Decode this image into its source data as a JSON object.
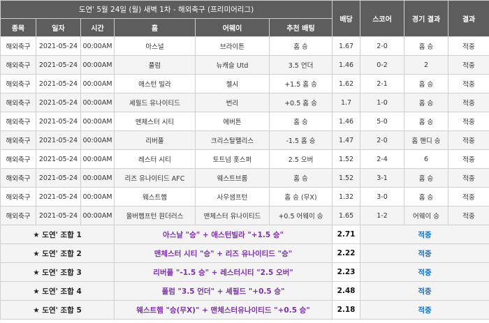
{
  "title": "도연' 5월 24일 (월) 새벽 1차 - 해외축구 (프리미어리그)",
  "headers": {
    "sport": "종목",
    "date": "일자",
    "time": "시간",
    "home": "홈",
    "away": "어웨이",
    "pick": "추천 배팅",
    "odds": "배당",
    "score": "스코어",
    "match_result": "경기 결과",
    "result": "결과"
  },
  "matches": [
    {
      "sport": "해외축구",
      "date": "2021-05-24",
      "time": "00:00AM",
      "home": "아스널",
      "away": "브라이튼",
      "pick": "홈 승",
      "odds": "1.67",
      "score": "2-0",
      "match_result": "홈 승",
      "result": "적중"
    },
    {
      "sport": "해외축구",
      "date": "2021-05-24",
      "time": "00:00AM",
      "home": "풀럼",
      "away": "뉴캐슬 Utd",
      "pick": "3.5 언더",
      "odds": "1.46",
      "score": "0-2",
      "match_result": "2",
      "result": "적중"
    },
    {
      "sport": "해외축구",
      "date": "2021-05-24",
      "time": "00:00AM",
      "home": "애스턴 빌라",
      "away": "첼시",
      "pick": "+1.5 홈 승",
      "odds": "1.62",
      "score": "2-1",
      "match_result": "홈 승",
      "result": "적중"
    },
    {
      "sport": "해외축구",
      "date": "2021-05-24",
      "time": "00:00AM",
      "home": "셰필드 유나이티드",
      "away": "번리",
      "pick": "+0.5 홈 승",
      "odds": "1.7",
      "score": "1-0",
      "match_result": "홈 승",
      "result": "적중"
    },
    {
      "sport": "해외축구",
      "date": "2021-05-24",
      "time": "00:00AM",
      "home": "맨체스터 시티",
      "away": "에버튼",
      "pick": "홈 승",
      "odds": "1.46",
      "score": "5-0",
      "match_result": "홈 승",
      "result": "적중"
    },
    {
      "sport": "해외축구",
      "date": "2021-05-24",
      "time": "00:00AM",
      "home": "리버풀",
      "away": "크리스탈팰리스",
      "pick": "-1.5 홈 승",
      "odds": "1.47",
      "score": "2-0",
      "match_result": "홈 핸디 승",
      "result": "적중"
    },
    {
      "sport": "해외축구",
      "date": "2021-05-24",
      "time": "00:00AM",
      "home": "레스터 시티",
      "away": "토트넘 홋스퍼",
      "pick": "2.5 오버",
      "odds": "1.52",
      "score": "2-4",
      "match_result": "6",
      "result": "적중"
    },
    {
      "sport": "해외축구",
      "date": "2021-05-24",
      "time": "00:00AM",
      "home": "리즈 유나이티드 AFC",
      "away": "웨스트브롬",
      "pick": "홈 승",
      "odds": "1.52",
      "score": "3-1",
      "match_result": "홈 승",
      "result": "적중"
    },
    {
      "sport": "해외축구",
      "date": "2021-05-24",
      "time": "00:00AM",
      "home": "웨스트햄",
      "away": "사우샘프턴",
      "pick": "홈 승 (무X)",
      "odds": "1.32",
      "score": "3-0",
      "match_result": "홈 승",
      "result": "적중"
    },
    {
      "sport": "해외축구",
      "date": "2021-05-24",
      "time": "00:00AM",
      "home": "울버햄프턴 원더러스",
      "away": "맨체스터 유나이티드",
      "pick": "+0.5 어웨이 승",
      "odds": "1.65",
      "score": "1-2",
      "match_result": "어웨이 승",
      "result": "적중"
    }
  ],
  "combos": [
    {
      "label": "★ 도연' 조합 1",
      "desc": "아스날 \"승\" + 애스턴빌라 \"+1.5 승\"",
      "odds": "2.71",
      "result": "적중"
    },
    {
      "label": "★ 도연' 조합 2",
      "desc": "맨체스터 시티 \"승\" + 리즈 유나이티드 \"승\"",
      "odds": "2.22",
      "result": "적중"
    },
    {
      "label": "★ 도연' 조합 3",
      "desc": "리버풀 \"-1.5 승\" + 레스터시티 \"2.5 오버\"",
      "odds": "2.23",
      "result": "적중"
    },
    {
      "label": "★ 도연' 조합 4",
      "desc": "풀럼 \"3.5 언더\" + 셰필드 \"+0.5 승\"",
      "odds": "2.48",
      "result": "적중"
    },
    {
      "label": "★ 도연' 조합 5",
      "desc": "웨스트햄 \"승(무X)\" + 맨체스터유나이티드 \"+0.5 승\"",
      "odds": "2.18",
      "result": "적중"
    }
  ]
}
